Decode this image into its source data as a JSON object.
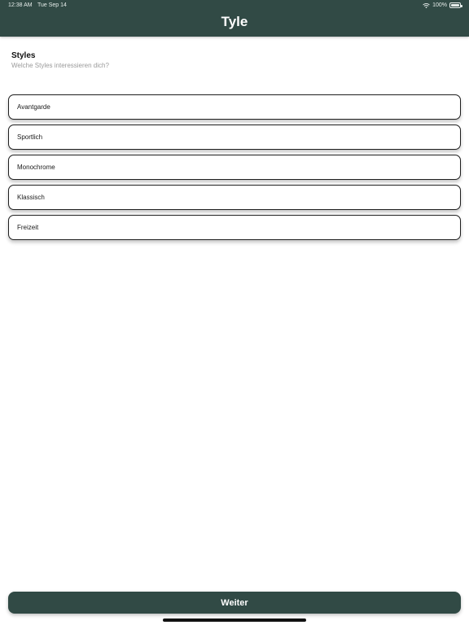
{
  "status_bar": {
    "time": "12:38 AM",
    "date": "Tue Sep 14",
    "battery": "100%"
  },
  "header": {
    "title": "Tyle"
  },
  "section": {
    "title": "Styles",
    "subtitle": "Welche Styles interessieren dich?"
  },
  "options": [
    {
      "label": "Avantgarde"
    },
    {
      "label": "Sportlich"
    },
    {
      "label": "Monochrome"
    },
    {
      "label": "Klassisch"
    },
    {
      "label": "Freizeit"
    }
  ],
  "footer": {
    "continue_label": "Weiter"
  },
  "colors": {
    "brand": "#314a45",
    "border": "#1f1f1f",
    "subtitle": "#9a9a9a"
  },
  "icons": {
    "wifi": "wifi-icon",
    "battery": "battery-icon"
  }
}
